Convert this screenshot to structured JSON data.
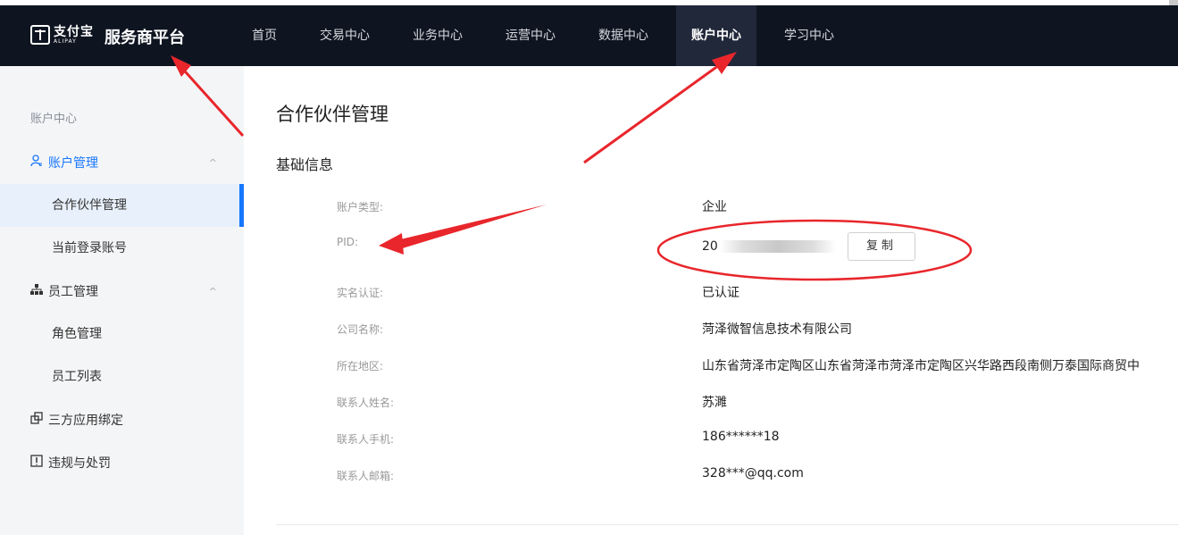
{
  "header": {
    "logo_cn": "支付宝",
    "logo_en": "ALIPAY",
    "platform": "服务商平台",
    "nav": [
      "首页",
      "交易中心",
      "业务中心",
      "运营中心",
      "数据中心",
      "账户中心",
      "学习中心"
    ],
    "active_nav": "账户中心"
  },
  "sidebar": {
    "title": "账户中心",
    "groups": [
      {
        "label": "账户管理",
        "icon": "user-icon",
        "chevron": "^",
        "items": [
          "合作伙伴管理",
          "当前登录账号"
        ]
      },
      {
        "label": "员工管理",
        "icon": "org-chart-icon",
        "chevron": "^",
        "items": [
          "角色管理",
          "员工列表"
        ]
      },
      {
        "label": "三方应用绑定",
        "icon": "app-bind-icon"
      },
      {
        "label": "违规与处罚",
        "icon": "violation-icon"
      }
    ],
    "active_item": "合作伙伴管理"
  },
  "main": {
    "page_title": "合作伙伴管理",
    "section_title": "基础信息",
    "copy_label": "复制",
    "fields": [
      {
        "label": "账户类型:",
        "value": "企业"
      },
      {
        "label": "PID:",
        "value": "20"
      },
      {
        "label": "实名认证:",
        "value": "已认证"
      },
      {
        "label": "公司名称:",
        "value": "菏泽微智信息技术有限公司"
      },
      {
        "label": "所在地区:",
        "value": "山东省菏泽市定陶区山东省菏泽市菏泽市定陶区兴华路西段南侧万泰国际商贸中"
      },
      {
        "label": "联系人姓名:",
        "value": "苏濉"
      },
      {
        "label": "联系人手机:",
        "value": "186******18"
      },
      {
        "label": "联系人邮箱:",
        "value": "328***@qq.com"
      }
    ]
  },
  "annotation_color": "#e8262b"
}
